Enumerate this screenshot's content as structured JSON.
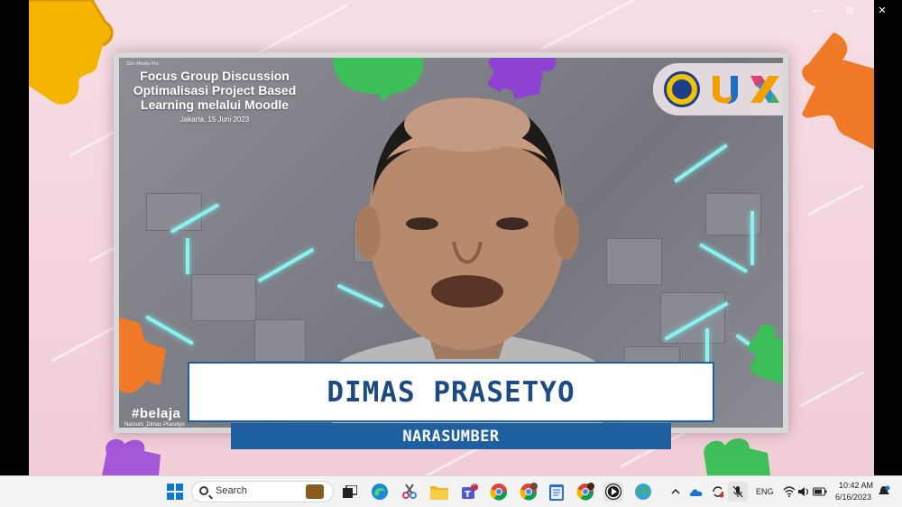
{
  "window": {
    "minimize_glyph": "—",
    "maximize_glyph": "⧉",
    "close_glyph": "✕"
  },
  "slide": {
    "tiny_header": "Zen Media Pro",
    "title_lines": [
      "Focus Group Discussion",
      "Optimalisasi Project Based",
      "Learning melalui Moodle"
    ],
    "date": "Jakarta, 15 Juni 2023",
    "hashtag": "#belaja",
    "participant_label": "Narsum_Dimas Prasetyo"
  },
  "lower_third": {
    "name": "DIMAS PRASETYO",
    "role": "NARASUMBER"
  },
  "colors": {
    "name_box_border": "#1e5fa0",
    "name_text": "#1e4a82",
    "role_bg": "#1e5fa0",
    "glow": "#8ef0ee"
  },
  "taskbar": {
    "search_label": "Search",
    "language": "ENG",
    "time": "10:42 AM",
    "date": "6/16/2023",
    "apps": [
      {
        "icon": "windows-start-icon"
      },
      {
        "icon": "task-view-icon"
      },
      {
        "icon": "edge-icon"
      },
      {
        "icon": "snipping-tool-icon"
      },
      {
        "icon": "file-explorer-icon"
      },
      {
        "icon": "teams-icon"
      },
      {
        "icon": "chrome-icon"
      },
      {
        "icon": "chrome-profile-icon"
      },
      {
        "icon": "notepad-icon"
      },
      {
        "icon": "chrome-profile2-icon"
      },
      {
        "icon": "media-player-icon"
      },
      {
        "icon": "globe-app-icon"
      }
    ],
    "teams_badge": "5"
  }
}
